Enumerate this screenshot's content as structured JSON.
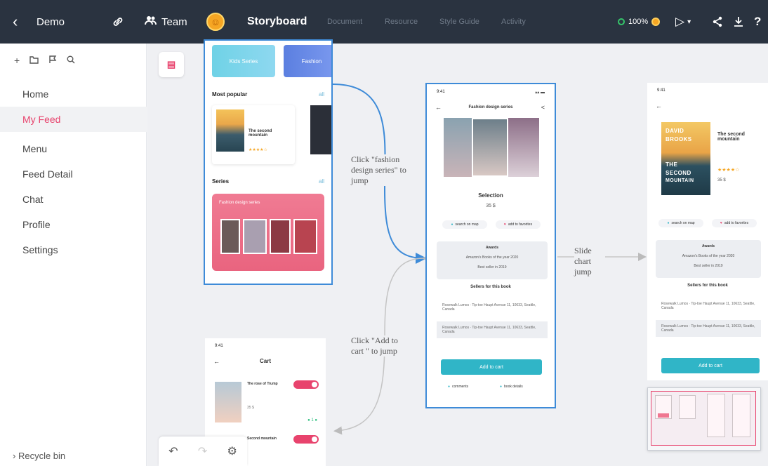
{
  "topbar": {
    "back_icon": "‹",
    "project": "Demo",
    "link_icon": "🔗",
    "team": "Team",
    "active_tab": "Storyboard",
    "tabs": [
      "Document",
      "Resource",
      "Style Guide",
      "Activity"
    ],
    "zoom": "100%",
    "play_icon": "▷",
    "dropdown_icon": "▾",
    "share_icon": "<",
    "download_icon": "⤓",
    "help": "?"
  },
  "sidebar": {
    "items": [
      {
        "label": "Home"
      },
      {
        "label": "My Feed"
      },
      {
        "label": "Menu"
      },
      {
        "label": "Feed Detail"
      },
      {
        "label": "Chat"
      },
      {
        "label": "Profile"
      },
      {
        "label": "Settings"
      }
    ],
    "recycle": "Recycle bin"
  },
  "annotations": {
    "fashion": "Click \"fashion design series\" to jump",
    "cart": "Click \"Add to cart \" to jump",
    "slide": "Slide chart jump"
  },
  "home_frame": {
    "categories": [
      "Kids Series",
      "Fashion"
    ],
    "popular": "Most popular",
    "popular_book": "The second mountain",
    "stars": "★★★★☆",
    "series": "Series",
    "series_card": "Fashion design series",
    "more": "all"
  },
  "detail_frame": {
    "time": "9:41",
    "signal": "▴▴ ▬",
    "header": "Fashion design series",
    "title": "Selection",
    "price": "35 $",
    "search_online": "search on map",
    "add_favorites": "add to favorites",
    "box_title": "Awards",
    "box_line1": "Amazon's Books of the year 2020",
    "box_line2": "Best seller in 2019",
    "sellers_title": "Sellers for this book",
    "seller1": "Rosewalk Lumos · Tip-toe Haupt Avenue 11, 10633, Seattle, Canada",
    "seller2": "Rosewalk Lumos · Tip-toe Haupt Avenue 11, 10633, Seattle, Canada",
    "add_to_cart": "Add to cart",
    "comments": "comments",
    "book_details": "book details"
  },
  "book_frame": {
    "time": "9:41",
    "cover_lines": [
      "DAVID",
      "BROOKS",
      "THE",
      "SECOND",
      "MOUNTAIN"
    ],
    "title": "The second mountain",
    "stars": "★★★★☆",
    "price": "35 $",
    "awards": "Awards",
    "add_to_cart": "Add to cart"
  },
  "cart_frame": {
    "time": "9:41",
    "title": "Cart",
    "item1": "The rose of Trump",
    "item2": "Second mountain",
    "price": "35 $",
    "qty": "● 1 ●"
  },
  "colors": {
    "accent": "#e8436d",
    "selection": "#3e8bd8",
    "topbar": "#2a3340",
    "cta": "#30b5c7"
  },
  "icons": [
    "chevron-left-icon",
    "link-icon",
    "team-icon",
    "avatar-icon",
    "status-icon",
    "play-icon",
    "share-icon",
    "download-icon",
    "help-icon",
    "plus-icon",
    "folder-icon",
    "flag-icon",
    "search-icon",
    "undo-icon",
    "redo-icon",
    "settings-icon"
  ]
}
